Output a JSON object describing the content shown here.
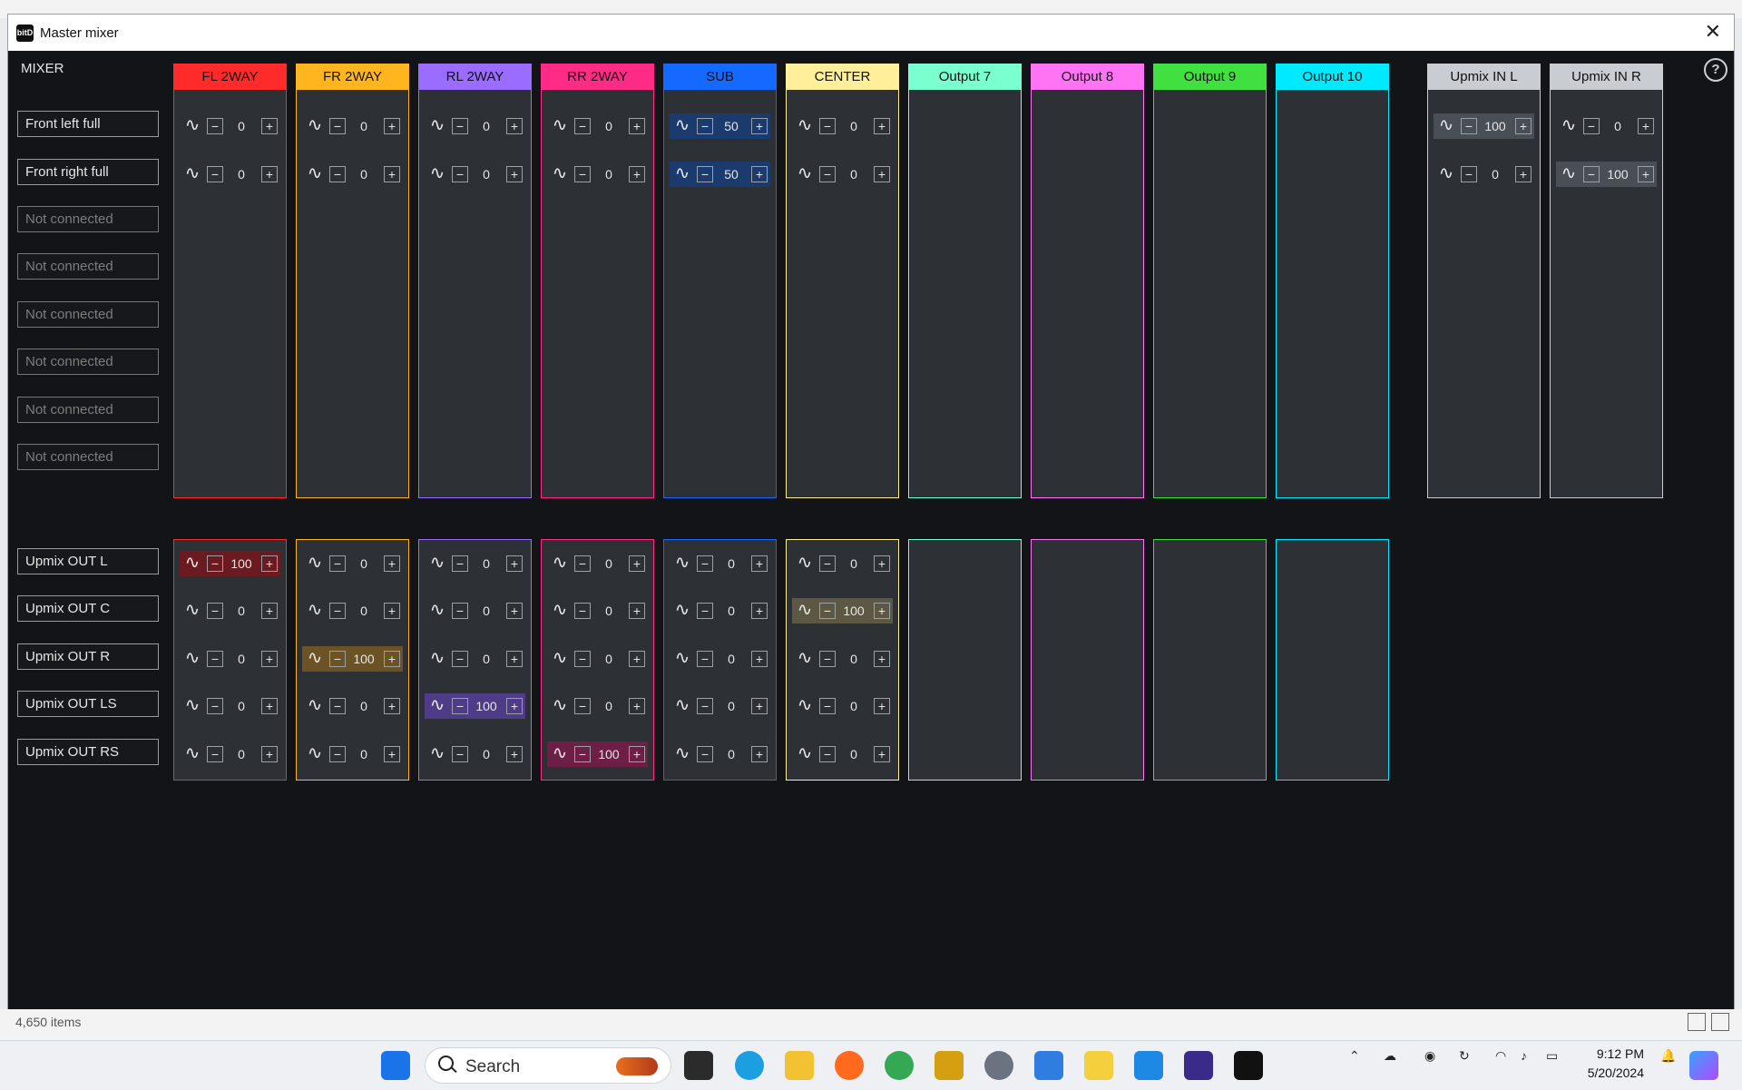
{
  "window": {
    "title": "Master mixer",
    "app_icon": "bitD"
  },
  "section_label": "MIXER",
  "help_icon": "?",
  "inputs_top": [
    "Front left full",
    "Front right full",
    "Not connected",
    "Not connected",
    "Not connected",
    "Not connected",
    "Not connected",
    "Not connected"
  ],
  "inputs_bottom": [
    "Upmix OUT L",
    "Upmix OUT C",
    "Upmix OUT R",
    "Upmix OUT LS",
    "Upmix OUT RS"
  ],
  "outputs": [
    {
      "name": "FL 2WAY",
      "color": "#ff2a2a",
      "bg": "#6b1a1f"
    },
    {
      "name": "FR 2WAY",
      "color": "#ffb51e",
      "bg": "#6b5326"
    },
    {
      "name": "RL 2WAY",
      "color": "#9a6cff",
      "bg": "#4f3c88"
    },
    {
      "name": "RR 2WAY",
      "color": "#ff2b86",
      "bg": "#6e1f45"
    },
    {
      "name": "SUB",
      "color": "#1569ff",
      "bg": "#1b3a6e"
    },
    {
      "name": "CENTER",
      "color": "#ffee9a",
      "bg": "#5c5844"
    },
    {
      "name": "Output 7",
      "color": "#7affd0",
      "bg": "#2d4b44"
    },
    {
      "name": "Output 8",
      "color": "#ff74f5",
      "bg": "#5a2d58"
    },
    {
      "name": "Output 9",
      "color": "#3fe03f",
      "bg": "#284c2b"
    },
    {
      "name": "Output 10",
      "color": "#00eaff",
      "bg": "#1d4c52"
    },
    {
      "name": "Upmix IN L",
      "color": "#c9ccd1",
      "bg": "#4a4e55"
    },
    {
      "name": "Upmix IN R",
      "color": "#c9ccd1",
      "bg": "#4a4e55"
    }
  ],
  "matrix_top": [
    [
      "0",
      "0"
    ],
    [
      "0",
      "0"
    ],
    [
      "0",
      "0"
    ],
    [
      "0",
      "0"
    ],
    [
      "50",
      "50"
    ],
    [
      "0",
      "0"
    ],
    [],
    [],
    [],
    [],
    [
      "100",
      "0"
    ],
    [
      "0",
      "100"
    ]
  ],
  "matrix_bottom": [
    [
      "100",
      "0",
      "0",
      "0",
      "0"
    ],
    [
      "0",
      "0",
      "100",
      "0",
      "0"
    ],
    [
      "0",
      "0",
      "0",
      "100",
      "0"
    ],
    [
      "0",
      "0",
      "0",
      "0",
      "100"
    ],
    [
      "0",
      "0",
      "0",
      "0",
      "0"
    ],
    [
      "0",
      "100",
      "0",
      "0",
      "0"
    ],
    [],
    [],
    [],
    []
  ],
  "status_bar": {
    "items": "4,650 items"
  },
  "taskbar": {
    "search_placeholder": "Search",
    "time": "9:12 PM",
    "date": "5/20/2024",
    "icons": [
      "windows-start",
      "task-view",
      "edge",
      "file-explorer",
      "firefox",
      "chrome",
      "app-gold",
      "settings",
      "app-blue",
      "app-notes",
      "app-photos",
      "rew",
      "bitd"
    ]
  }
}
